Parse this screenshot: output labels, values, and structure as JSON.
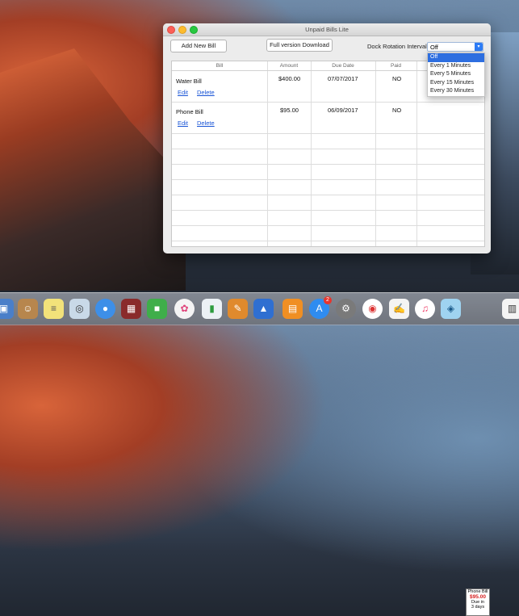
{
  "window": {
    "title": "Unpaid Bills Lite",
    "add_button": "Add New Bill",
    "full_button": "Full version Download",
    "dock_rotation_label": "Dock Rotation Interval:",
    "dock_rotation_selected": "Off",
    "dock_rotation_options": [
      "Off",
      "Every 1 Minutes",
      "Every 5 Minutes",
      "Every 15 Minutes",
      "Every 30 Minutes"
    ]
  },
  "table": {
    "headers": {
      "bill": "Bill",
      "amount": "Amount",
      "due_date": "Due Date",
      "paid": "Paid"
    },
    "rows": [
      {
        "bill": "Water Bill",
        "amount": "$400.00",
        "due_date": "07/07/2017",
        "paid": "NO",
        "edit": "Edit",
        "delete": "Delete"
      },
      {
        "bill": "Phone Bill",
        "amount": "$95.00",
        "due_date": "06/09/2017",
        "paid": "NO",
        "edit": "Edit",
        "delete": "Delete"
      }
    ]
  },
  "dock": {
    "badge_count": "2",
    "widget": {
      "title": "Phone Bill",
      "amount": "$95.00",
      "due_line1": "Due in",
      "due_line2": "3 days"
    },
    "colors": {
      "accent": "#2d6ee0",
      "link": "#1a55d6",
      "close": "#fc5f57",
      "min": "#fdbc2e",
      "max": "#28c840"
    }
  }
}
